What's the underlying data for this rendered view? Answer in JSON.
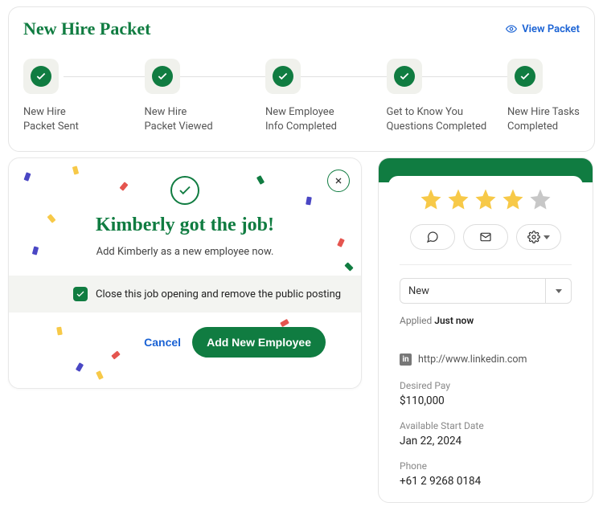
{
  "packet": {
    "title": "New Hire Packet",
    "view_label": "View Packet",
    "steps": [
      "New Hire\nPacket Sent",
      "New Hire\nPacket Viewed",
      "New Employee\nInfo Completed",
      "Get to Know You\nQuestions Completed",
      "New Hire Tasks\nCompleted"
    ]
  },
  "modal": {
    "title": "Kimberly got the job!",
    "subtitle": "Add Kimberly as a new employee now.",
    "close_opening_label": "Close this job opening and remove the public posting",
    "close_opening_checked": true,
    "cancel_label": "Cancel",
    "primary_label": "Add New Employee"
  },
  "candidate": {
    "rating": 4,
    "status_selected": "New",
    "applied_prefix": "Applied",
    "applied_value": "Just now",
    "linkedin": "http://www.linkedin.com",
    "desired_pay_label": "Desired Pay",
    "desired_pay_value": "$110,000",
    "start_date_label": "Available Start Date",
    "start_date_value": "Jan 22, 2024",
    "phone_label": "Phone",
    "phone_value": "+61 2 9268 0184"
  },
  "colors": {
    "accent": "#107c41",
    "link": "#1a62d4",
    "star": "#f7c948"
  }
}
